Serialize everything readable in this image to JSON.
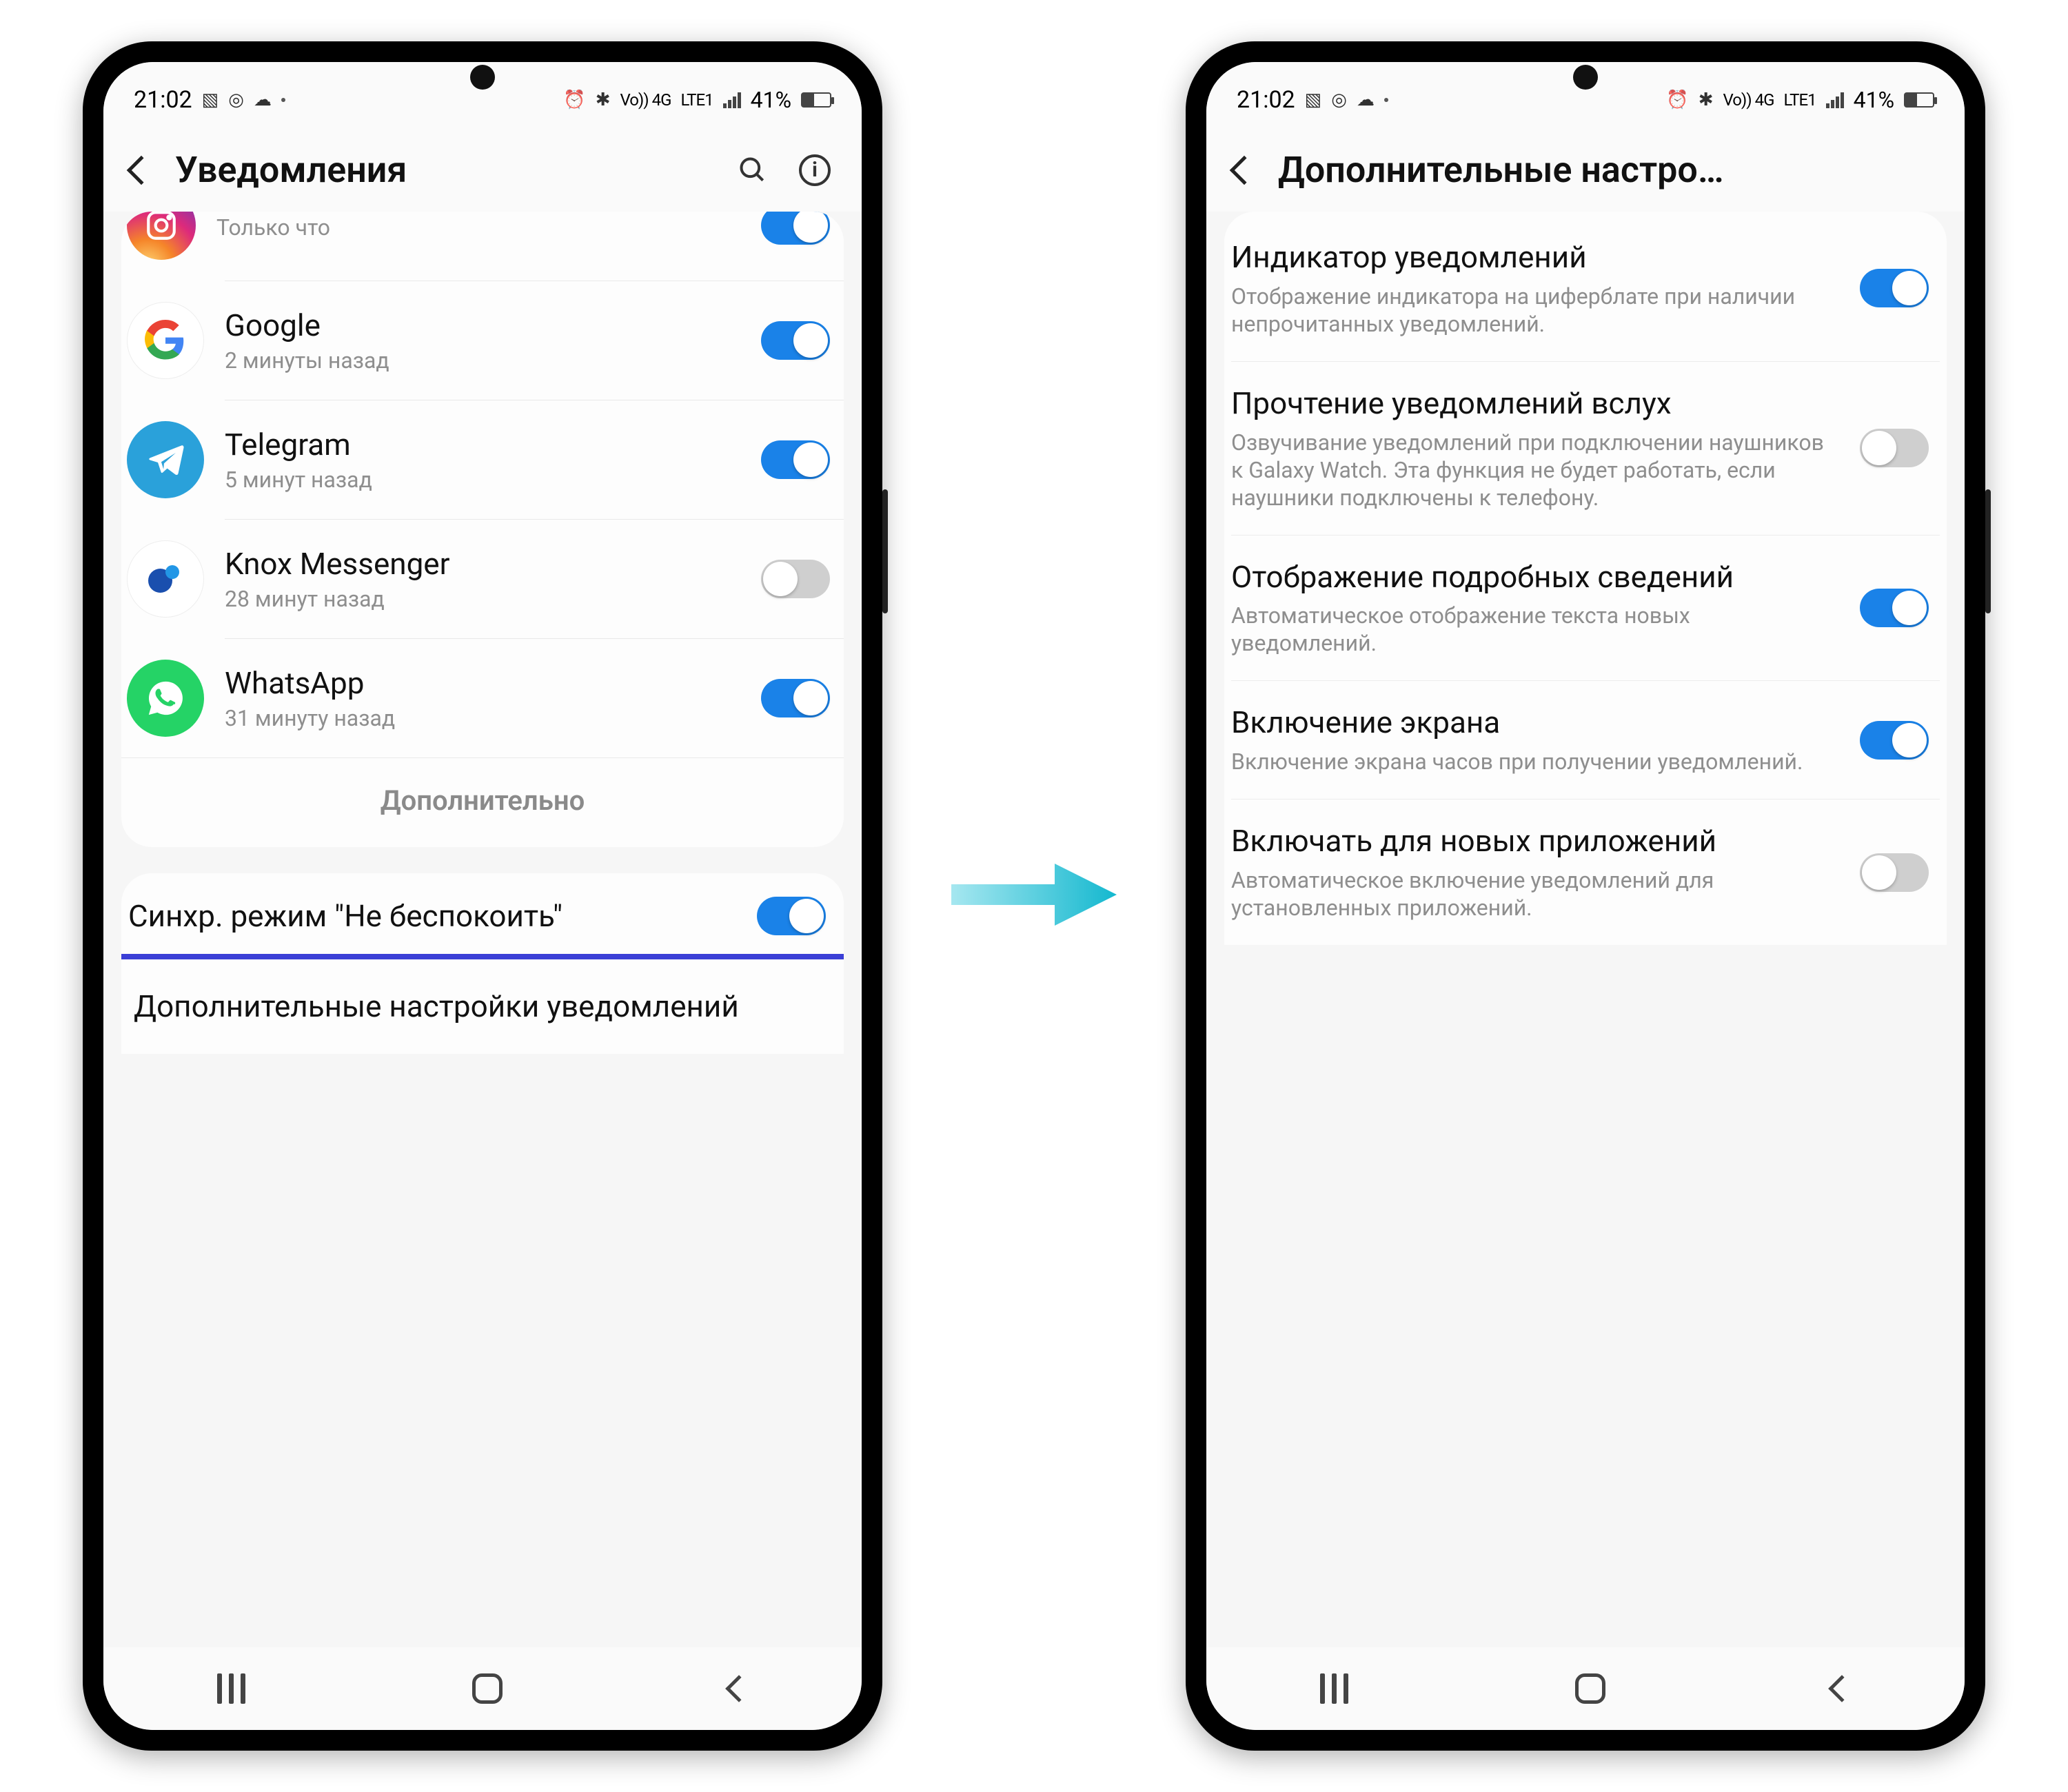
{
  "status_bar": {
    "time": "21:02",
    "battery_pct": "41%",
    "net_label": "Vo)) 4G",
    "lte_label": "LTE1"
  },
  "left_screen": {
    "title": "Уведомления",
    "apps": [
      {
        "name": "Instagram",
        "sub": "Только что",
        "icon": "insta",
        "on": true,
        "cut": true
      },
      {
        "name": "Google",
        "sub": "2 минуты назад",
        "icon": "google",
        "on": true
      },
      {
        "name": "Telegram",
        "sub": "5 минут назад",
        "icon": "tg",
        "on": true
      },
      {
        "name": "Knox Messenger",
        "sub": "28 минут назад",
        "icon": "knox",
        "on": false
      },
      {
        "name": "WhatsApp",
        "sub": "31 минуту назад",
        "icon": "wa",
        "on": true
      }
    ],
    "more_label": "Дополнительно",
    "dnd_sync_label": "Синхр. режим \"Не беспокоить\"",
    "dnd_sync_on": true,
    "advanced_label": "Дополнительные настройки уведомлений"
  },
  "right_screen": {
    "title": "Дополнительные настро…",
    "items": [
      {
        "title": "Индикатор уведомлений",
        "desc": "Отображение индикатора на циферблате при наличии непрочитанных уведомлений.",
        "on": true
      },
      {
        "title": "Прочтение уведомлений вслух",
        "desc": "Озвучивание уведомлений при подключении наушников к Galaxy Watch. Эта функция не будет работать, если наушники подключены к телефону.",
        "on": false
      },
      {
        "title": "Отображение подробных сведений",
        "desc": "Автоматическое отображение текста новых уведомлений.",
        "on": true
      },
      {
        "title": "Включение экрана",
        "desc": "Включение экрана часов при получении уведомлений.",
        "on": true
      },
      {
        "title": "Включать для новых приложений",
        "desc": "Автоматическое включение уведомлений для установленных приложений.",
        "on": false
      }
    ]
  }
}
